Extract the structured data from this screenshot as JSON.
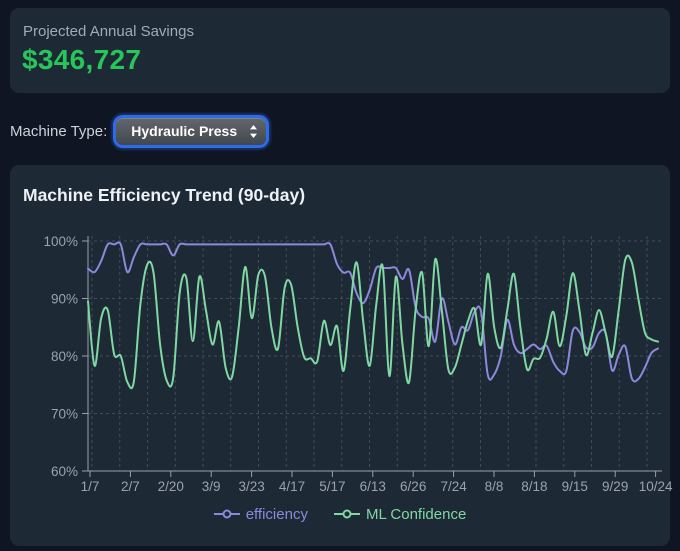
{
  "savings_card": {
    "label": "Projected Annual Savings",
    "value": "$346,727",
    "value_color": "#27c65b"
  },
  "machine_type": {
    "label": "Machine Type:",
    "selected": "Hydraulic Press",
    "focus_ring_color": "#2e6be8"
  },
  "chart_card": {
    "title": "Machine Efficiency Trend (90-day)"
  },
  "chart_data": {
    "type": "line",
    "title": "Machine Efficiency Trend (90-day)",
    "ylim": [
      60,
      100
    ],
    "y_ticks": [
      "100%",
      "90%",
      "80%",
      "70%",
      "60%"
    ],
    "x_tick_labels": [
      "1/7",
      "2/7",
      "2/20",
      "3/9",
      "3/23",
      "4/17",
      "5/17",
      "6/13",
      "6/26",
      "7/24",
      "8/8",
      "8/18",
      "9/15",
      "9/29",
      "10/24"
    ],
    "grid": true,
    "grid_style": "dashed",
    "legend_position": "bottom",
    "series": [
      {
        "name": "efficiency",
        "color": "#8c89dc",
        "values": [
          95.2,
          94.6,
          96.5,
          99.4,
          99.4,
          99.4,
          94.6,
          97.2,
          99.4,
          99.4,
          99.4,
          99.4,
          99.4,
          97.5,
          99.4,
          99.4,
          99.4,
          99.4,
          99.4,
          99.4,
          99.4,
          99.4,
          99.4,
          99.4,
          99.4,
          99.4,
          99.4,
          99.4,
          99.4,
          99.4,
          99.4,
          99.4,
          99.4,
          99.4,
          99.4,
          99.4,
          99.4,
          99.4,
          96.0,
          94.5,
          94.5,
          90.9,
          89.2,
          91.5,
          95.3,
          95.3,
          95.3,
          95.3,
          93.4,
          95.0,
          88.5,
          86.8,
          86.5,
          82.5,
          90.0,
          86.0,
          82.0,
          85.0,
          84.5,
          87.7,
          87.7,
          76.8,
          76.8,
          80.0,
          86.3,
          82.0,
          80.5,
          81.2,
          82.0,
          81.2,
          81.8,
          79.0,
          77.4,
          77.4,
          84.4,
          84.2,
          81.5,
          81.5,
          84.0,
          84.0,
          77.5,
          80.2,
          81.7,
          76.1,
          76.0,
          78.0,
          80.5,
          81.3
        ]
      },
      {
        "name": "ML Confidence",
        "color": "#7fd8a2",
        "values": [
          89.5,
          78.3,
          86.5,
          88.0,
          80.3,
          80.0,
          75.5,
          75.6,
          89.0,
          95.8,
          94.5,
          82.0,
          75.8,
          76.2,
          91.0,
          93.6,
          82.6,
          93.8,
          88.0,
          82.0,
          86.0,
          78.0,
          76.4,
          85.0,
          95.5,
          86.6,
          94.1,
          93.9,
          85.0,
          81.3,
          91.8,
          92.4,
          85.0,
          79.8,
          79.6,
          79.1,
          86.1,
          81.9,
          85.2,
          77.4,
          88.0,
          96.3,
          86.0,
          78.3,
          89.0,
          95.5,
          76.5,
          93.8,
          82.0,
          75.4,
          88.0,
          94.5,
          81.7,
          96.8,
          88.0,
          77.7,
          78.0,
          82.0,
          86.1,
          88.2,
          82.0,
          94.3,
          85.0,
          81.4,
          88.0,
          94.3,
          85.0,
          77.7,
          79.5,
          79.7,
          83.0,
          87.7,
          81.7,
          87.0,
          94.4,
          88.0,
          80.2,
          84.0,
          88.0,
          84.0,
          79.9,
          88.0,
          96.7,
          96.3,
          90.0,
          84.1,
          82.9,
          82.5
        ]
      }
    ]
  }
}
